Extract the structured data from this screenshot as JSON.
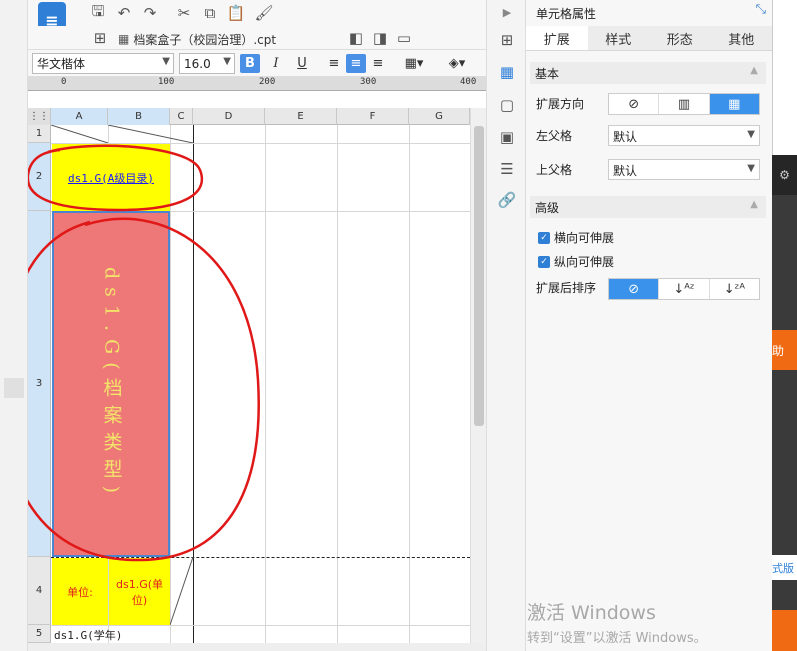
{
  "toolbar": {
    "icons": [
      "app-logo-icon",
      "save-icon",
      "undo-icon",
      "redo-icon",
      "cut-icon",
      "copy-icon",
      "paste-icon",
      "format-painter-icon"
    ]
  },
  "tab": {
    "doc_title": "档案盒子（校园治理）.cpt"
  },
  "format_bar": {
    "font_name": "华文楷体",
    "font_size": "16.0",
    "bold": "B",
    "italic": "I",
    "underline": "U"
  },
  "ruler": {
    "labels": [
      "0",
      "100",
      "200",
      "300",
      "400"
    ]
  },
  "sheet": {
    "columns": [
      "A",
      "B",
      "C",
      "D",
      "E",
      "F",
      "G"
    ],
    "rows": [
      "1",
      "2",
      "3",
      "4",
      "5"
    ],
    "a2_text": "ds1.G(A级目录)",
    "b3_text": "ds1.G(档案类型)",
    "a4_text": "单位:",
    "b4_text": "ds1.G(单位)",
    "a5_text": "ds1.G(学年)"
  },
  "panel": {
    "title": "单元格属性",
    "tabs": [
      "扩展",
      "样式",
      "形态",
      "其他"
    ],
    "active_tab": "扩展",
    "section_basic": "基本",
    "expand_direction_label": "扩展方向",
    "left_parent_label": "左父格",
    "left_parent_value": "默认",
    "top_parent_label": "上父格",
    "top_parent_value": "默认",
    "section_advanced": "高级",
    "horizontal_expandable": "横向可伸展",
    "vertical_expandable": "纵向可伸展",
    "sort_after_expand_label": "扩展后排序"
  },
  "watermark": {
    "line1": "激活 Windows",
    "line2": "转到“设置”以激活 Windows。"
  },
  "background_app": {
    "text1": "助",
    "text2": "式版"
  }
}
